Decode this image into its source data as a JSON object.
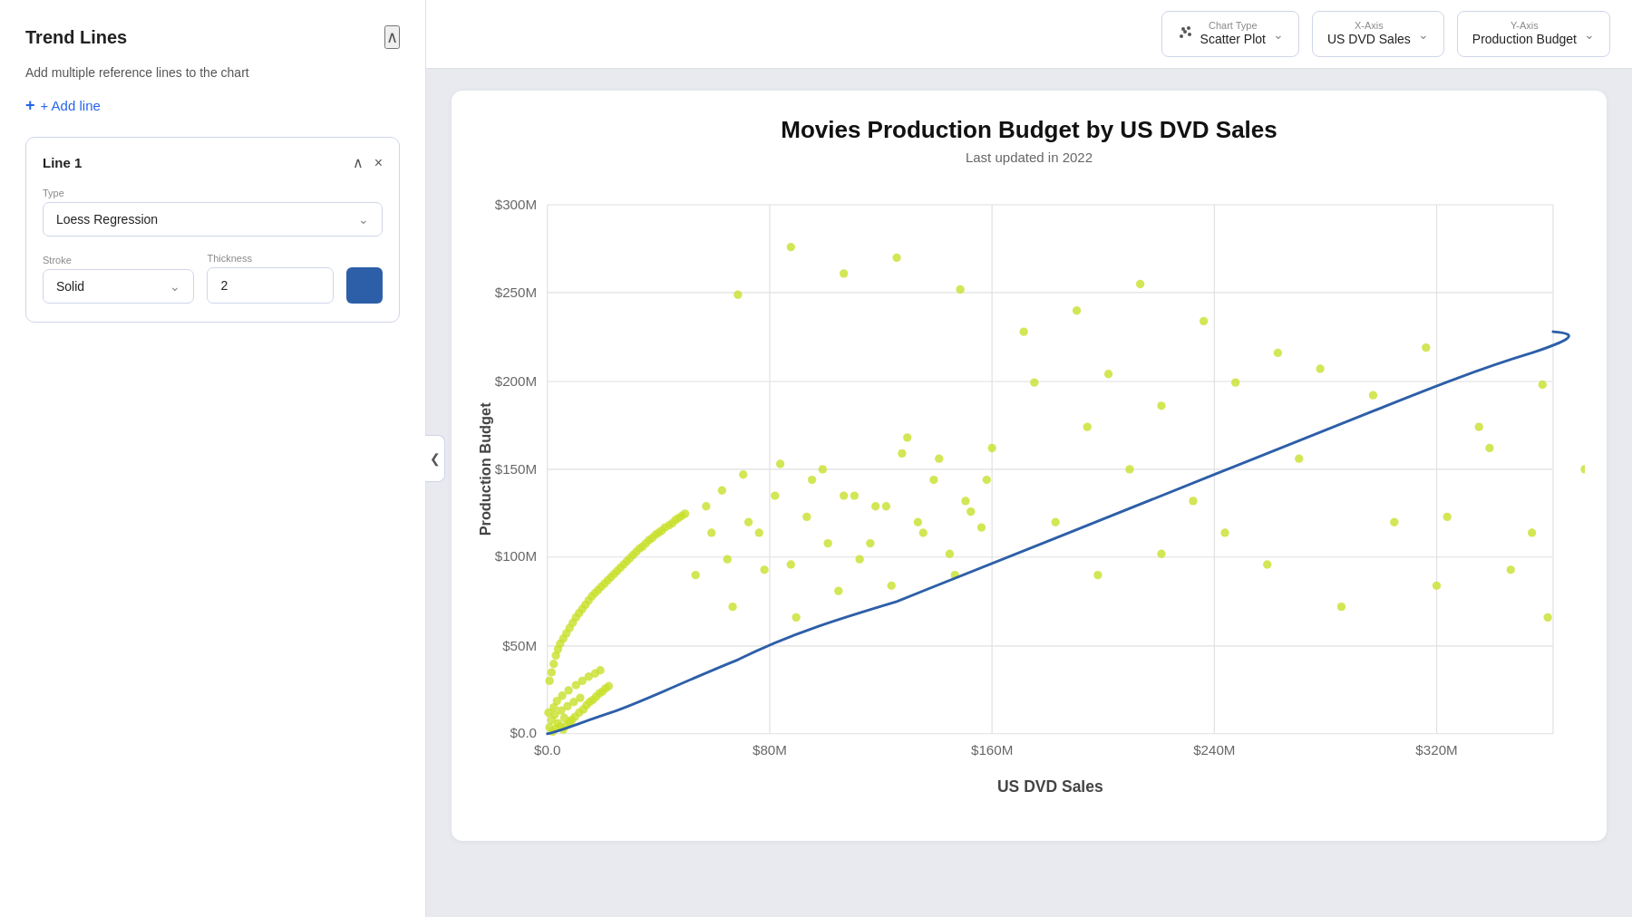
{
  "sidebar": {
    "title": "Trend Lines",
    "description": "Add multiple reference lines to the chart",
    "add_line_label": "+ Add line",
    "line1": {
      "title": "Line 1",
      "type_label": "Type",
      "type_value": "Loess Regression",
      "stroke_label": "Stroke",
      "stroke_value": "Solid",
      "thickness_label": "Thickness",
      "thickness_value": "2",
      "color": "#2d5fa8"
    }
  },
  "toolbar": {
    "chart_type_label": "Chart Type",
    "chart_type_value": "Scatter Plot",
    "x_axis_label": "X-Axis",
    "x_axis_value": "US DVD Sales",
    "y_axis_label": "Y-Axis",
    "y_axis_value": "Production Budget"
  },
  "chart": {
    "title": "Movies Production Budget by US DVD Sales",
    "subtitle": "Last updated in 2022",
    "x_axis_title": "US DVD Sales",
    "y_axis_title": "Production Budget",
    "y_ticks": [
      "$300M",
      "$250M",
      "$200M",
      "$150M",
      "$100M",
      "$50M",
      "$0.0"
    ],
    "x_ticks": [
      "$0.0",
      "$80M",
      "$160M",
      "$240M",
      "$320M"
    ]
  },
  "icons": {
    "collapse": "‹",
    "expand": "›",
    "chevron_up": "∧",
    "chevron_down": "⌄",
    "close": "×",
    "scatter_icon": "⊙",
    "plus": "+"
  }
}
